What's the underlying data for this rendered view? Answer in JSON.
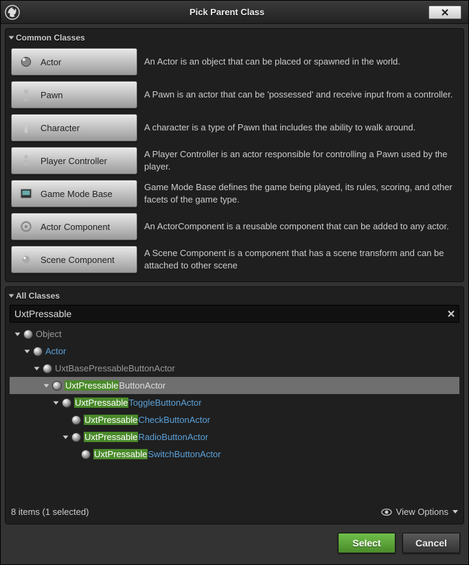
{
  "window": {
    "title": "Pick Parent Class"
  },
  "sections": {
    "common": {
      "header": "Common Classes"
    },
    "all": {
      "header": "All Classes"
    }
  },
  "common_classes": [
    {
      "name": "actor",
      "label": "Actor",
      "desc": "An Actor is an object that can be placed or spawned in the world."
    },
    {
      "name": "pawn",
      "label": "Pawn",
      "desc": "A Pawn is an actor that can be 'possessed' and receive input from a controller."
    },
    {
      "name": "character",
      "label": "Character",
      "desc": "A character is a type of Pawn that includes the ability to walk around."
    },
    {
      "name": "player-controller",
      "label": "Player Controller",
      "desc": "A Player Controller is an actor responsible for controlling a Pawn used by the player."
    },
    {
      "name": "game-mode-base",
      "label": "Game Mode Base",
      "desc": "Game Mode Base defines the game being played, its rules, scoring, and other facets of the game type."
    },
    {
      "name": "actor-component",
      "label": "Actor Component",
      "desc": "An ActorComponent is a reusable component that can be added to any actor."
    },
    {
      "name": "scene-component",
      "label": "Scene Component",
      "desc": "A Scene Component is a component that has a scene transform and can be attached to other scene"
    }
  ],
  "search": {
    "value": "UxtPressable"
  },
  "tree": [
    {
      "depth": 0,
      "expander": "open",
      "label": "Object",
      "style": "dim",
      "hl": "",
      "rest": "Object",
      "selected": false
    },
    {
      "depth": 1,
      "expander": "open",
      "label": "Actor",
      "style": "link",
      "hl": "",
      "rest": "Actor",
      "selected": false
    },
    {
      "depth": 2,
      "expander": "open",
      "label": "UxtBasePressableButtonActor",
      "style": "dim",
      "hl": "",
      "rest": "UxtBasePressableButtonActor",
      "selected": false
    },
    {
      "depth": 3,
      "expander": "open",
      "label": "UxtPressableButtonActor",
      "style": "plain",
      "hl": "UxtPressable",
      "rest": "ButtonActor",
      "selected": true
    },
    {
      "depth": 4,
      "expander": "open",
      "label": "UxtPressableToggleButtonActor",
      "style": "link",
      "hl": "UxtPressable",
      "rest": "ToggleButtonActor",
      "selected": false
    },
    {
      "depth": 5,
      "expander": "none",
      "label": "UxtPressableCheckButtonActor",
      "style": "link",
      "hl": "UxtPressable",
      "rest": "CheckButtonActor",
      "selected": false
    },
    {
      "depth": 5,
      "expander": "open",
      "label": "UxtPressableRadioButtonActor",
      "style": "link",
      "hl": "UxtPressable",
      "rest": "RadioButtonActor",
      "selected": false
    },
    {
      "depth": 6,
      "expander": "none",
      "label": "UxtPressableSwitchButtonActor",
      "style": "link",
      "hl": "UxtPressable",
      "rest": "SwitchButtonActor",
      "selected": false
    }
  ],
  "footer": {
    "status": "8 items (1 selected)",
    "view_options": "View Options"
  },
  "buttons": {
    "select": "Select",
    "cancel": "Cancel"
  }
}
